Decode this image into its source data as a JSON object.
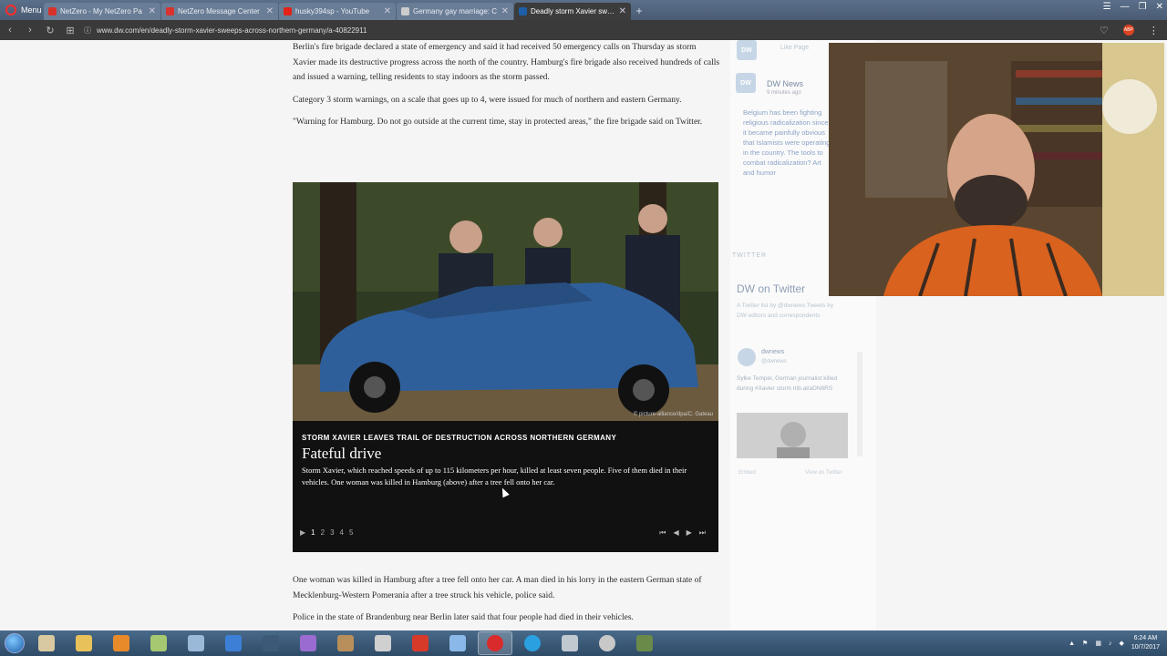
{
  "browser": {
    "menu_label": "Menu",
    "tabs": [
      {
        "title": "NetZero - My NetZero Pa",
        "favicon_color": "#d9322c"
      },
      {
        "title": "NetZero Message Center",
        "favicon_color": "#d9322c"
      },
      {
        "title": "husky394sp - YouTube",
        "favicon_color": "#e62117"
      },
      {
        "title": "Germany gay marriage: C",
        "favicon_color": "#cccccc"
      },
      {
        "title": "Deadly storm Xavier swee",
        "favicon_color": "#1d5fa8"
      }
    ],
    "url": "www.dw.com/en/deadly-storm-xavier-sweeps-across-northern-germany/a-40822911"
  },
  "article": {
    "paragraphs": [
      "Berlin's fire brigade declared a state of emergency and said it had received 50 emergency calls on Thursday as storm Xavier made its destructive progress across the north of the country. Hamburg's fire brigade also received hundreds of calls and issued a warning, telling residents to stay indoors as the storm passed.",
      "Category 3 storm warnings, on a scale that goes up to 4, were issued for much of northern and eastern Germany.",
      "\"Warning for Hamburg. Do not go outside at the current time, stay in protected areas,\" the fire brigade said on Twitter."
    ],
    "gallery": {
      "credit": "© picture-alliance/dpa/C. Gateau",
      "kicker": "STORM XAVIER LEAVES TRAIL OF DESTRUCTION ACROSS NORTHERN GERMANY",
      "title": "Fateful drive",
      "caption": "Storm Xavier, which reached speeds of up to 115 kilometers per hour, killed at least seven people. Five of them died in their vehicles. One woman was killed in Hamburg (above) after a tree fell onto her car.",
      "pages": [
        "1",
        "2",
        "3",
        "4",
        "5"
      ],
      "current_page": "1",
      "controls": {
        "first": "⏮",
        "prev": "◀",
        "next": "▶",
        "last": "⏭",
        "play": "▶"
      }
    },
    "after_paragraphs": [
      "One woman was killed in Hamburg after a tree fell onto her car. A man died in his lorry in the eastern German state of Mecklenburg-Western Pomerania after a tree struck his vehicle, police said.",
      "Police in the state of Brandenburg near Berlin later said that four people had died in their vehicles."
    ]
  },
  "sidebar": {
    "like_page": "Like Page",
    "fb_name": "DW News",
    "fb_time": "9 minutes ago",
    "fb_post": "Belgium has been fighting religious radicalization since it became painfully obvious that Islamists were operating in the country. The tools to combat radicalization? Art and humor",
    "twitter_label": "TWITTER",
    "twitter_title": "DW on Twitter",
    "twitter_sub": "A Twitter list by @dwnews Tweets by DW editors and correspondents",
    "tweet_handle": "dwnews",
    "tweet_handle2": "@dwnews",
    "tweet_text": "Sylke Tempel, German journalist killed during #Xavier storm trib.al/aDN8RS",
    "footer_left": "Embed",
    "footer_right": "View on Twitter"
  },
  "taskbar": {
    "time": "6:24 AM",
    "date": "10/7/2017",
    "icons": [
      {
        "name": "windows-explorer-icon",
        "color": "#d9c9a0"
      },
      {
        "name": "folder-icon",
        "color": "#e8c15a"
      },
      {
        "name": "media-player-icon",
        "color": "#e88a2a"
      },
      {
        "name": "notepad-icon",
        "color": "#a6c870"
      },
      {
        "name": "paint-icon",
        "color": "#9ab8d8"
      },
      {
        "name": "browser-ie-icon",
        "color": "#3b7fd6"
      },
      {
        "name": "steam-icon",
        "color": "#3c5a78"
      },
      {
        "name": "photo-icon",
        "color": "#9a6bd0"
      },
      {
        "name": "user-icon",
        "color": "#b88f5a"
      },
      {
        "name": "camera-icon",
        "color": "#d0d0d0"
      },
      {
        "name": "game-icon",
        "color": "#d83a2a"
      },
      {
        "name": "network-icon",
        "color": "#8ab8e8"
      },
      {
        "name": "opera-icon",
        "color": "#d92b2b"
      },
      {
        "name": "skype-icon",
        "color": "#2aa0e0"
      },
      {
        "name": "calculator-icon",
        "color": "#c0c8d0"
      },
      {
        "name": "disc-icon",
        "color": "#c8c8c8"
      },
      {
        "name": "tool-icon",
        "color": "#6a8a4a"
      }
    ]
  }
}
